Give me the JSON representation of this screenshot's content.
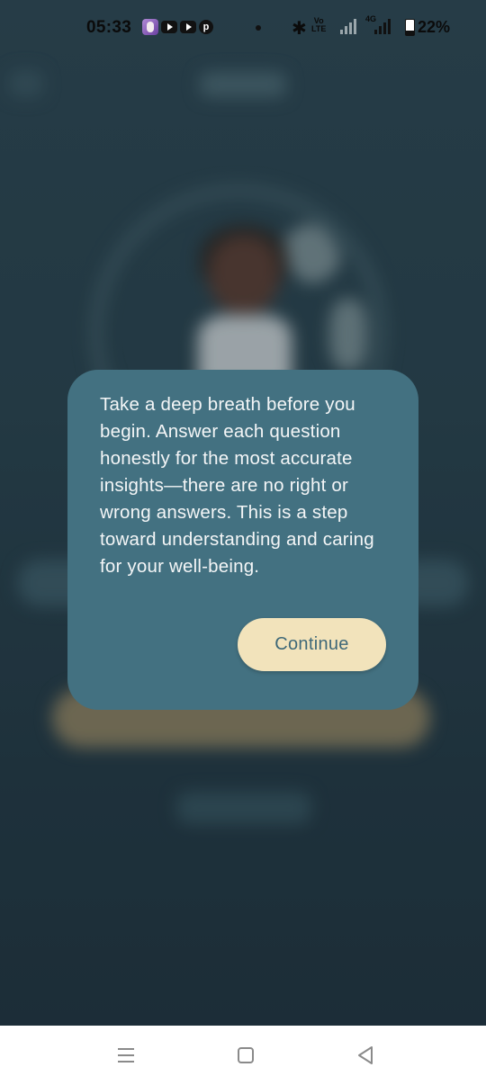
{
  "status_bar": {
    "time": "05:33",
    "network_label": "4G",
    "volte_label": "Vo\nLTE",
    "battery": "22%",
    "icons": [
      "avatar-notification-icon",
      "youtube-icon",
      "youtube-icon",
      "pinterest-icon",
      "bluetooth-icon",
      "signal-icon",
      "battery-icon"
    ]
  },
  "dialog": {
    "message": "Take a deep breath before you begin. Answer each question honestly for the most accurate insights—there are no right or wrong answers. This is a step toward understanding and caring for your well-being.",
    "continue_label": "Continue"
  },
  "nav_bar": {
    "icons": [
      "menu-icon",
      "home-icon",
      "back-icon"
    ]
  },
  "colors": {
    "dialog_bg": "#437181",
    "button_bg": "#f2e3bb",
    "button_text": "#3e6878",
    "backdrop": "#233641"
  }
}
